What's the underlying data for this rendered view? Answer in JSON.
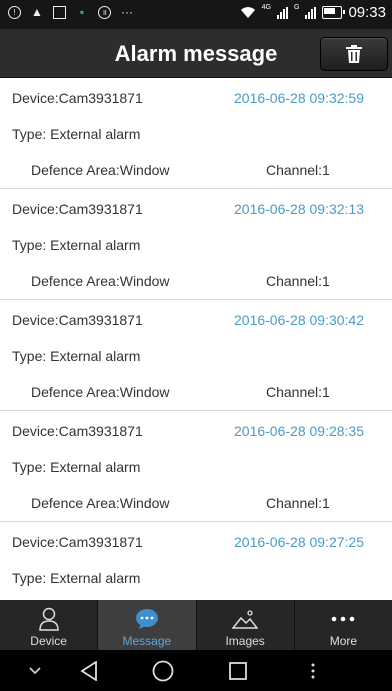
{
  "status_bar": {
    "network_1": "4G",
    "network_2": "G",
    "time": "09:33"
  },
  "header": {
    "title": "Alarm message",
    "delete_icon": "trash-icon"
  },
  "alarms": [
    {
      "device": "Device:Cam3931871",
      "time": "2016-06-28 09:32:59",
      "type": "Type:  External alarm",
      "area": "Defence Area:Window",
      "channel": "Channel:1"
    },
    {
      "device": "Device:Cam3931871",
      "time": "2016-06-28 09:32:13",
      "type": "Type:  External alarm",
      "area": "Defence Area:Window",
      "channel": "Channel:1"
    },
    {
      "device": "Device:Cam3931871",
      "time": "2016-06-28 09:30:42",
      "type": "Type:  External alarm",
      "area": "Defence Area:Window",
      "channel": "Channel:1"
    },
    {
      "device": "Device:Cam3931871",
      "time": "2016-06-28 09:28:35",
      "type": "Type:  External alarm",
      "area": "Defence Area:Window",
      "channel": "Channel:1"
    },
    {
      "device": "Device:Cam3931871",
      "time": "2016-06-28 09:27:25",
      "type": "Type:  External alarm",
      "area": "",
      "channel": ""
    }
  ],
  "tabs": [
    {
      "label": "Device",
      "icon": "person-icon",
      "active": false
    },
    {
      "label": "Message",
      "icon": "chat-bubble-icon",
      "active": true
    },
    {
      "label": "Images",
      "icon": "image-icon",
      "active": false
    },
    {
      "label": "More",
      "icon": "more-dots-icon",
      "active": false
    }
  ],
  "colors": {
    "accent": "#5aa8d8",
    "timestamp": "#4a9bc6",
    "titlebar": "#2d2d2d"
  }
}
